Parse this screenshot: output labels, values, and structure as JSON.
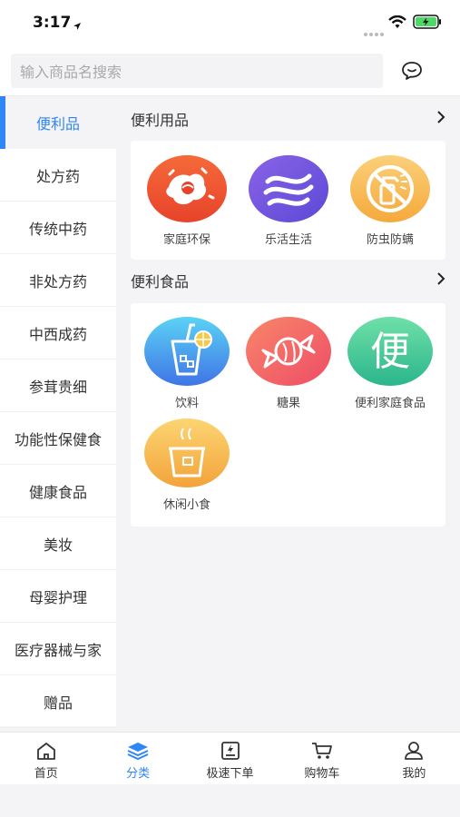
{
  "status": {
    "time": "3:17"
  },
  "search": {
    "placeholder": "输入商品名搜索"
  },
  "sidebar": {
    "items": [
      {
        "label": "便利品",
        "active": true
      },
      {
        "label": "处方药"
      },
      {
        "label": "传统中药"
      },
      {
        "label": "非处方药"
      },
      {
        "label": "中西成药"
      },
      {
        "label": "参茸贵细"
      },
      {
        "label": "功能性保健食"
      },
      {
        "label": "健康食品"
      },
      {
        "label": "美妆"
      },
      {
        "label": "母婴护理"
      },
      {
        "label": "医疗器械与家"
      },
      {
        "label": "赠品"
      }
    ]
  },
  "sections": [
    {
      "title": "便利用品",
      "items": [
        {
          "label": "家庭环保",
          "icon": "household-eco-icon"
        },
        {
          "label": "乐活生活",
          "icon": "lohas-life-icon"
        },
        {
          "label": "防虫防螨",
          "icon": "insect-mite-spray-icon"
        }
      ]
    },
    {
      "title": "便利食品",
      "items": [
        {
          "label": "饮料",
          "icon": "drink-icon"
        },
        {
          "label": "糖果",
          "icon": "candy-icon"
        },
        {
          "label": "便利家庭食品",
          "icon": "convenience-char-icon",
          "glyph": "便"
        },
        {
          "label": "休闲小食",
          "icon": "snack-cup-icon"
        }
      ]
    }
  ],
  "tabbar": {
    "items": [
      {
        "label": "首页",
        "icon": "home-icon"
      },
      {
        "label": "分类",
        "icon": "category-stack-icon",
        "active": true
      },
      {
        "label": "极速下单",
        "icon": "quick-order-icon"
      },
      {
        "label": "购物车",
        "icon": "cart-icon"
      },
      {
        "label": "我的",
        "icon": "profile-icon"
      }
    ]
  },
  "colors": {
    "accent": "#2f86f6",
    "background": "#f4f4f6"
  }
}
